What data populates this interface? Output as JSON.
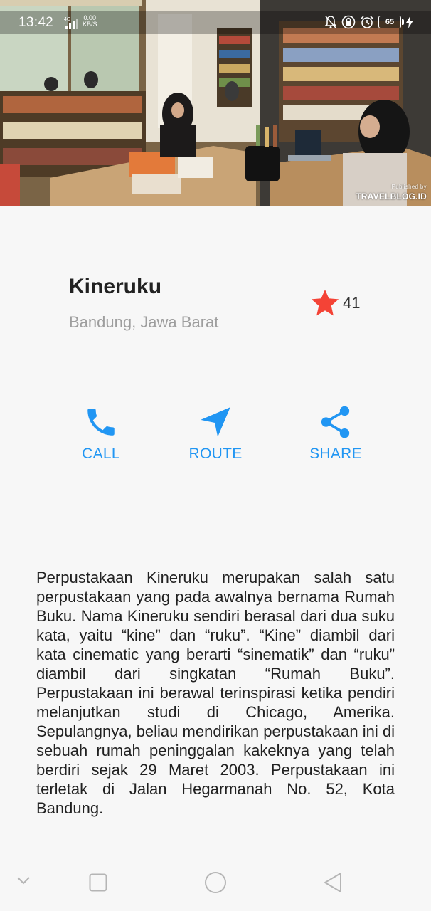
{
  "status_bar": {
    "time": "13:42",
    "network": "4G",
    "speed_value": "0.00",
    "speed_unit": "KB/S",
    "battery": "65"
  },
  "hero": {
    "watermark_small": "Published by",
    "watermark_brand": "TRAVELBLOG.ID"
  },
  "place": {
    "name": "Kineruku",
    "region": "Bandung, Jawa Barat",
    "rating_count": "41"
  },
  "actions": {
    "call": "CALL",
    "route": "ROUTE",
    "share": "SHARE"
  },
  "description": "Perpustakaan Kineruku merupakan salah satu perpustakaan yang pada awalnya bernama Rumah Buku. Nama Kineruku sendiri berasal dari dua suku kata, yaitu “kine” dan “ruku”. “Kine” diambil dari kata cinematic yang berarti “sinematik” dan “ruku” diambil dari singkatan “Rumah Buku”. Perpustakaan ini berawal terinspirasi ketika pendiri melanjutkan studi di Chicago, Amerika. Sepulangnya, beliau mendirikan perpustakaan ini di sebuah rumah peninggalan kakeknya yang telah berdiri sejak 29 Maret 2003. Perpustakaan ini terletak di Jalan Hegarmanah No. 52, Kota Bandung.",
  "colors": {
    "accent": "#2196f3",
    "star": "#f44336",
    "title": "#222222",
    "subtitle": "#9e9e9e"
  },
  "icons": {
    "call": "phone-icon",
    "route": "navigation-arrow-icon",
    "share": "share-icon",
    "rating": "star-icon"
  }
}
